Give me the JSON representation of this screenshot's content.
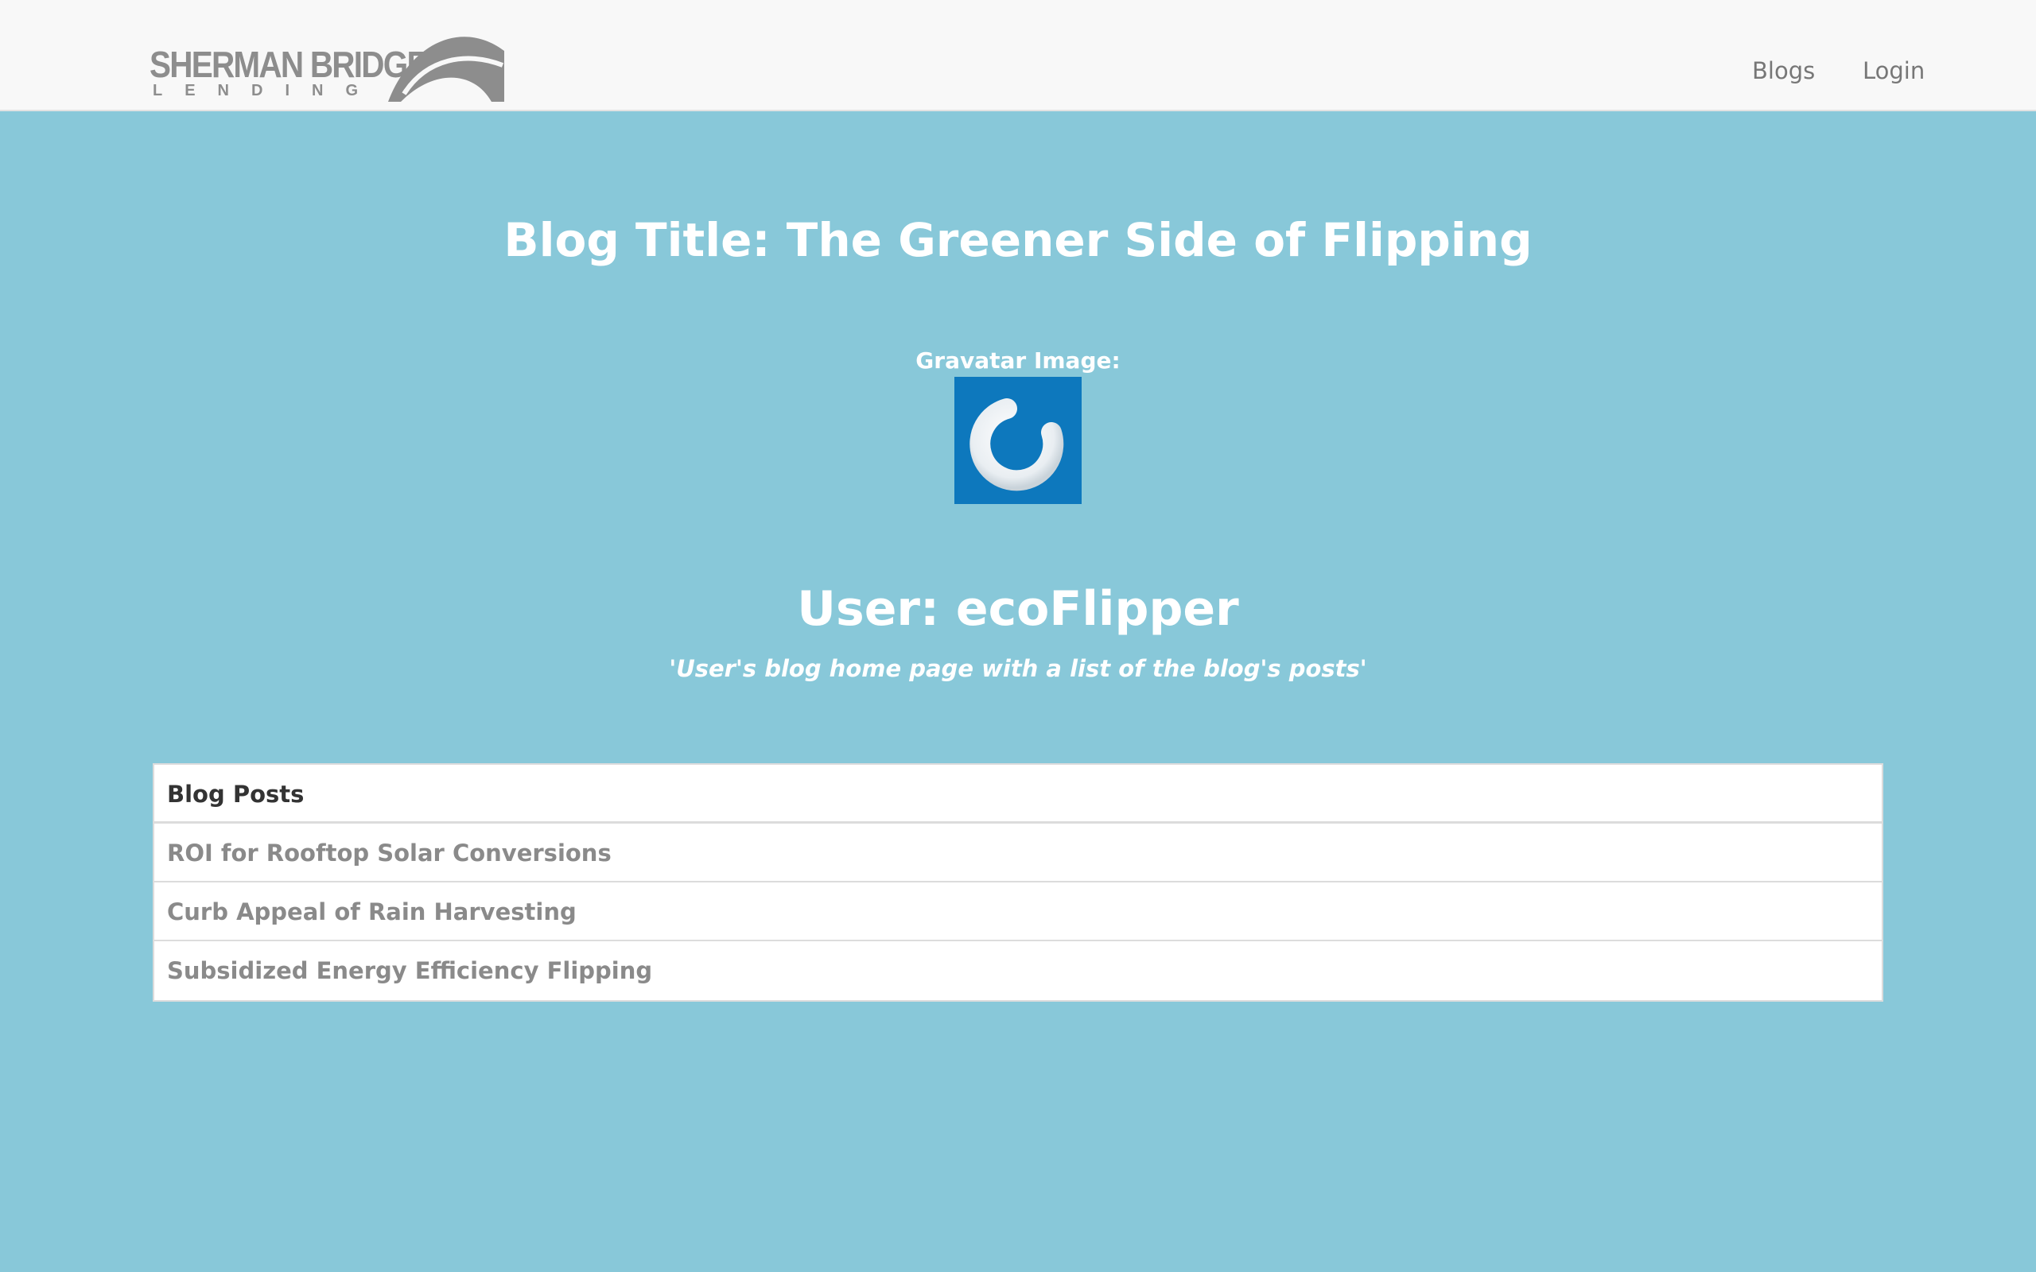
{
  "header": {
    "logo": {
      "wordmark": "SHERMAN BRIDGE",
      "subtext": "LENDING"
    },
    "nav": {
      "blogs_label": "Blogs",
      "login_label": "Login"
    }
  },
  "main": {
    "blog_title": "Blog Title: The Greener Side of Flipping",
    "gravatar_label": "Gravatar Image:",
    "user_heading": "User: ecoFlipper",
    "tagline": "'User's blog home page with a list of the blog's posts'"
  },
  "posts": {
    "header": "Blog Posts",
    "items": [
      "ROI for Rooftop Solar Conversions",
      "Curb Appeal of Rain Harvesting",
      "Subsidized Energy Efficiency Flipping"
    ]
  },
  "colors": {
    "page_background": "#88c8d9",
    "navbar_background": "#f8f8f8",
    "gravatar_blue": "#0d78bd",
    "logo_gray": "#8d8d8d"
  }
}
